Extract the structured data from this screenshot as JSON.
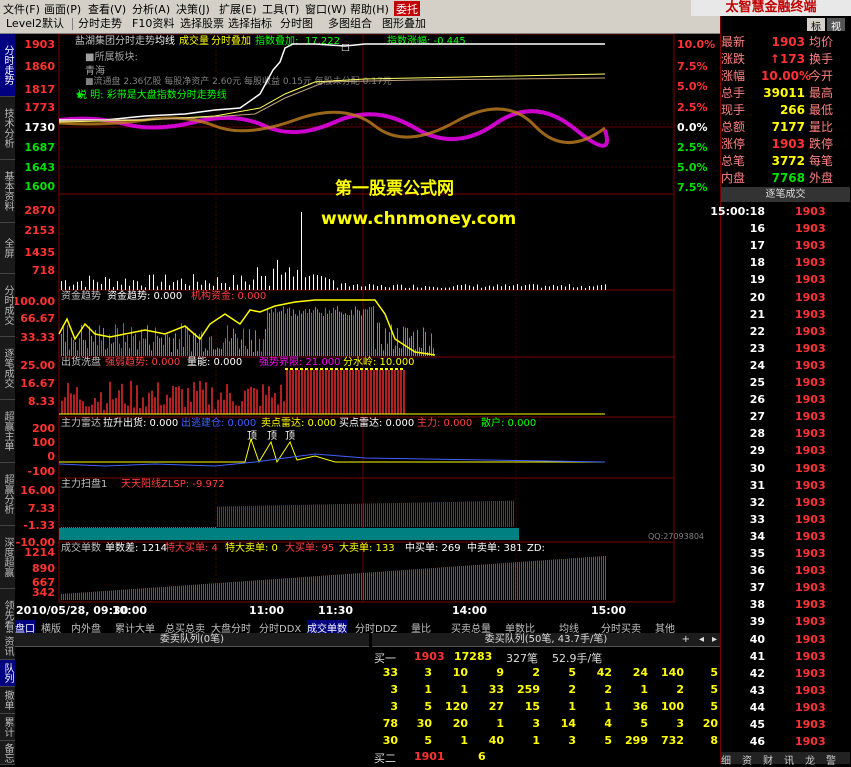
{
  "menubar": {
    "items": [
      "文件(F)",
      "画面(P)",
      "查看(V)",
      "分析(A)",
      "决策(J)",
      "扩展(E)",
      "工具(T)",
      "窗口(W)",
      "帮助(H)",
      "委托"
    ],
    "brand": "太智慧金融终端"
  },
  "toolbar": {
    "items": [
      "Level2默认",
      "分时走势",
      "F10资料",
      "选择股票",
      "选择指标",
      "分时图",
      "多图组合",
      "图形叠加"
    ]
  },
  "left_tabs": [
    "分时走势",
    "技术分析",
    "基本资料",
    "全屏",
    "分时成交",
    "逐笔成交",
    "超赢主单",
    "超赢分析",
    "深度超赢",
    "领先看盘"
  ],
  "header_line": {
    "name": "盐湖集团分时走势",
    "avg": "均线",
    "vol": "成交量",
    "overlay": "分时叠加",
    "index_overlay": "指数叠加:",
    "index_value": "17.222",
    "index_change": "指数涨幅: -0.445"
  },
  "info_box": {
    "block_label": "■所属板块:",
    "block_value": "青海",
    "share_line": "■流通盘 2.36亿股  每股净资产 2.60元  每股收益 0.15元  每股未分配 0.17元",
    "note": "说 明: 彩带是大盘指数分时走势线"
  },
  "price_axis": [
    "1903",
    "1860",
    "1817",
    "1773",
    "1730",
    "1687",
    "1643",
    "1600"
  ],
  "pct_axis_up": [
    "10.0%",
    "7.5%",
    "5.0%",
    "2.5%",
    "0.0%"
  ],
  "pct_axis_down": [
    "2.5%",
    "5.0%",
    "7.5%"
  ],
  "vol_axis": [
    "2870",
    "2153",
    "1435",
    "718"
  ],
  "watermark": {
    "line1": "第一股票公式网",
    "line2": "www.chnmoney.com"
  },
  "panels": {
    "p1": {
      "title": "资金趋势",
      "l1": "资金趋势: 0.000",
      "l2": "机构资金: 0.000",
      "axis": [
        "100.00",
        "66.67",
        "33.33"
      ]
    },
    "p2": {
      "title": "出货洗盘",
      "l1": "强弱趋势: 0.000",
      "l2": "量能: 0.000",
      "l3": "强势界限: 21.000",
      "l4": "分水岭: 10.000",
      "axis": [
        "25.00",
        "16.67",
        "8.33"
      ]
    },
    "p3": {
      "title": "主力雷达",
      "l1": "拉升出货: 0.000",
      "l2": "出逃建仓: 0.000",
      "l3": "卖点雷达: 0.000",
      "l4": "买点雷达: 0.000",
      "l5": "主力: 0.000",
      "l6": "散户: 0.000",
      "axis": [
        "200",
        "100",
        "0",
        "-100"
      ],
      "marks": [
        "顶",
        "顶",
        "顶"
      ]
    },
    "p4": {
      "title": "主力扫盘1",
      "l1": "天天阳线ZLSP: -9.972",
      "axis": [
        "16.00",
        "7.33",
        "-1.33",
        "-10.00"
      ],
      "note": "QQ:27093804"
    },
    "p5": {
      "title": "成交单数",
      "l1": "单数差: 1214",
      "l2": "特大买单: 4",
      "l3": "特大卖单: 0",
      "l4": "大买单: 95",
      "l5": "大卖单: 133",
      "l6": "中买单: 269",
      "l7": "中卖单: 381",
      "l8": "ZD:",
      "axis": [
        "1214",
        "890",
        "667",
        "342"
      ]
    }
  },
  "time_axis": {
    "start": "2010/05/28, 09:30",
    "labels": [
      "10:00",
      "11:00",
      "11:30",
      "14:00",
      "15:00"
    ]
  },
  "bottom_tabs": [
    "盘口",
    "横版",
    "内外盘",
    "累计大单",
    "总买总卖",
    "大盘分时",
    "分时DDX",
    "成交单数",
    "分时DDZ",
    "量比",
    "买卖总量",
    "单数比",
    "均线",
    "分时买卖",
    "其他"
  ],
  "queue": {
    "left_title": "委卖队列(0笔)",
    "right_title": "委买队列(50笔, 43.7手/笔)",
    "buy1": {
      "label": "买一",
      "price": "1903",
      "vol": "17283",
      "count": "327笔",
      "avg": "52.9手/笔"
    },
    "rows": [
      [
        "33",
        "3",
        "10",
        "9",
        "2",
        "5",
        "42",
        "24",
        "140",
        "5"
      ],
      [
        "3",
        "1",
        "1",
        "33",
        "259",
        "2",
        "2",
        "1",
        "2",
        "5"
      ],
      [
        "3",
        "5",
        "120",
        "27",
        "15",
        "1",
        "1",
        "36",
        "100",
        "5"
      ],
      [
        "78",
        "30",
        "20",
        "1",
        "3",
        "14",
        "4",
        "5",
        "3",
        "20"
      ],
      [
        "30",
        "5",
        "1",
        "40",
        "1",
        "3",
        "5",
        "299",
        "732",
        "8"
      ]
    ],
    "buy2": {
      "label": "买二",
      "price": "1901",
      "vol": "6"
    }
  },
  "right_panel": {
    "title": "标",
    "tab2": "视",
    "stats": [
      {
        "l": "最新",
        "v": "1903",
        "r": "均价"
      },
      {
        "l": "涨跌",
        "v": "↑173",
        "r": "换手"
      },
      {
        "l": "涨幅",
        "v": "10.00%",
        "r": "今开"
      },
      {
        "l": "总手",
        "v": "39011",
        "r": "最高"
      },
      {
        "l": "现手",
        "v": "266",
        "r": "最低"
      },
      {
        "l": "总额",
        "v": "7177",
        "r": "量比"
      },
      {
        "l": "涨停",
        "v": "1903",
        "r": "跌停"
      },
      {
        "l": "总笔",
        "v": "3772",
        "r": "每笔"
      },
      {
        "l": "内盘",
        "v": "7768",
        "r": "外盘"
      }
    ],
    "ticks_title": "逐笔成交",
    "ticks": [
      {
        "t": "15:00:18",
        "p": "1903"
      },
      {
        "t": "16",
        "p": "1903"
      },
      {
        "t": "17",
        "p": "1903"
      },
      {
        "t": "18",
        "p": "1903"
      },
      {
        "t": "19",
        "p": "1903"
      },
      {
        "t": "20",
        "p": "1903"
      },
      {
        "t": "21",
        "p": "1903"
      },
      {
        "t": "22",
        "p": "1903"
      },
      {
        "t": "23",
        "p": "1903"
      },
      {
        "t": "24",
        "p": "1903"
      },
      {
        "t": "25",
        "p": "1903"
      },
      {
        "t": "26",
        "p": "1903"
      },
      {
        "t": "27",
        "p": "1903"
      },
      {
        "t": "28",
        "p": "1903"
      },
      {
        "t": "29",
        "p": "1903"
      },
      {
        "t": "30",
        "p": "1903"
      },
      {
        "t": "31",
        "p": "1903"
      },
      {
        "t": "32",
        "p": "1903"
      },
      {
        "t": "33",
        "p": "1903"
      },
      {
        "t": "34",
        "p": "1903"
      },
      {
        "t": "35",
        "p": "1903"
      },
      {
        "t": "36",
        "p": "1903"
      },
      {
        "t": "37",
        "p": "1903"
      },
      {
        "t": "38",
        "p": "1903"
      },
      {
        "t": "39",
        "p": "1903"
      },
      {
        "t": "40",
        "p": "1903"
      },
      {
        "t": "41",
        "p": "1903"
      },
      {
        "t": "42",
        "p": "1903"
      },
      {
        "t": "43",
        "p": "1903"
      },
      {
        "t": "44",
        "p": "1903"
      },
      {
        "t": "45",
        "p": "1903"
      },
      {
        "t": "46",
        "p": "1903"
      }
    ],
    "bottom_tabs": [
      "细",
      "资",
      "财",
      "讯",
      "龙",
      "警"
    ]
  },
  "queue_side_tabs": [
    "资讯",
    "队列",
    "撤单",
    "累计",
    "备忘"
  ],
  "colors": {
    "up": "#ff3232",
    "down": "#00e000",
    "yellow": "#ffff00",
    "frame": "#800000"
  }
}
